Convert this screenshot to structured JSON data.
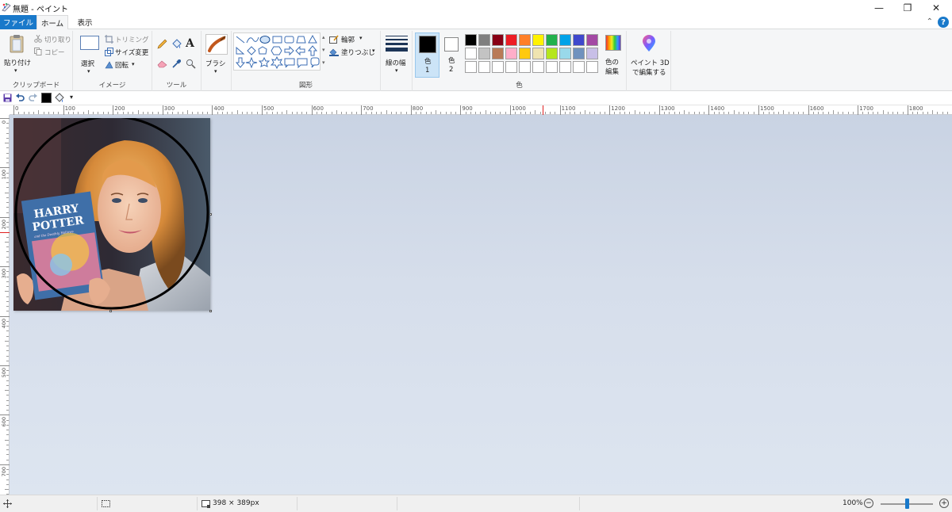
{
  "window": {
    "title": "無題 - ペイント",
    "minimize_glyph": "—",
    "maximize_glyph": "❐",
    "close_glyph": "✕"
  },
  "tabs": {
    "file": "ファイル",
    "home": "ホーム",
    "view": "表示"
  },
  "ribbon": {
    "clipboard": {
      "paste": "貼り付け",
      "cut": "切り取り",
      "copy": "コピー",
      "group": "クリップボード"
    },
    "image": {
      "select": "選択",
      "crop": "トリミング",
      "resize": "サイズ変更",
      "rotate": "回転",
      "group": "イメージ"
    },
    "tools": {
      "group": "ツール",
      "text_glyph": "A"
    },
    "brushes": {
      "label": "ブラシ"
    },
    "shapes": {
      "outline": "輪郭",
      "fill": "塗りつぶし",
      "group": "図形"
    },
    "size": {
      "label": "線の幅"
    },
    "colors": {
      "color1": "色",
      "color1_num": "1",
      "color2": "色",
      "color2_num": "2",
      "edit": "色の編集",
      "edit_line1": "色の",
      "edit_line2": "編集",
      "group": "色",
      "palette_row1": [
        "#000000",
        "#7f7f7f",
        "#880015",
        "#ed1c24",
        "#ff7f27",
        "#fff200",
        "#22b14c",
        "#00a2e8",
        "#3f48cc",
        "#a349a4"
      ],
      "palette_row2": [
        "#ffffff",
        "#c3c3c3",
        "#b97a57",
        "#ffaec9",
        "#ffc90e",
        "#efe4b0",
        "#b5e61d",
        "#99d9ea",
        "#7092be",
        "#c8bfe7"
      ],
      "primary": "#000000",
      "secondary": "#ffffff"
    },
    "paint3d": {
      "line1": "ペイント 3D",
      "line2": "で編集する"
    }
  },
  "canvas": {
    "book_title_1": "HARRY",
    "book_title_2": "POTTER",
    "book_subtitle": "and the Deathly Hallows"
  },
  "rulers": {
    "horizontal": [
      "0",
      "100",
      "200",
      "300",
      "400",
      "500",
      "600",
      "700",
      "800",
      "900",
      "1000",
      "1100",
      "1200",
      "1300",
      "1400",
      "1500",
      "1600",
      "1700",
      "1800"
    ],
    "vertical": [
      "0",
      "100",
      "200",
      "300",
      "400",
      "500",
      "600",
      "700"
    ]
  },
  "status": {
    "image_size": "398 × 389px",
    "zoom": "100%",
    "zoom_fraction": 0.5
  }
}
